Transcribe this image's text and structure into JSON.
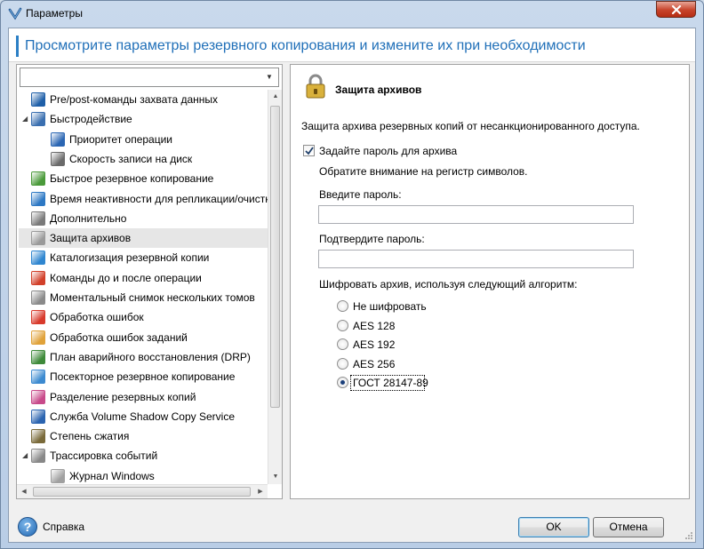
{
  "window": {
    "title": "Параметры"
  },
  "header": {
    "text": "Просмотрите параметры резервного копирования и измените их при необходимости"
  },
  "tree": {
    "items": [
      {
        "label": "Pre/post-команды захвата данных",
        "expander": "",
        "icon": "terminal-icon",
        "color": "#1e5fa8"
      },
      {
        "label": "Быстродействие",
        "expander": "◢",
        "icon": "monitor-icon",
        "color": "#3a6fb0"
      },
      {
        "label": "Приоритет операции",
        "expander": "",
        "icon": "priority-icon",
        "color": "#2b66b3"
      },
      {
        "label": "Скорость записи на диск",
        "expander": "",
        "icon": "disk-speed-icon",
        "color": "#6a6a6a"
      },
      {
        "label": "Быстрое резервное копирование",
        "expander": "",
        "icon": "fast-backup-icon",
        "color": "#4a9a3a"
      },
      {
        "label": "Время неактивности для репликации/очистки",
        "expander": "",
        "icon": "clock-icon",
        "color": "#2d78c4"
      },
      {
        "label": "Дополнительно",
        "expander": "",
        "icon": "gear-icon",
        "color": "#7a7a7a"
      },
      {
        "label": "Защита архивов",
        "expander": "",
        "icon": "lock-icon",
        "color": "#9a9a9a"
      },
      {
        "label": "Каталогизация резервной копии",
        "expander": "",
        "icon": "catalog-icon",
        "color": "#2f86d0"
      },
      {
        "label": "Команды до и после операции",
        "expander": "",
        "icon": "commands-icon",
        "color": "#d2402a"
      },
      {
        "label": "Моментальный снимок нескольких томов",
        "expander": "",
        "icon": "snapshot-icon",
        "color": "#8a8a8a"
      },
      {
        "label": "Обработка ошибок",
        "expander": "",
        "icon": "error-icon",
        "color": "#d83a2c"
      },
      {
        "label": "Обработка ошибок заданий",
        "expander": "",
        "icon": "task-error-icon",
        "color": "#e0a23a"
      },
      {
        "label": "План аварийного восстановления (DRP)",
        "expander": "",
        "icon": "drp-icon",
        "color": "#3e8a3a"
      },
      {
        "label": "Посекторное резервное копирование",
        "expander": "",
        "icon": "sector-icon",
        "color": "#3c8ad0"
      },
      {
        "label": "Разделение резервных копий",
        "expander": "",
        "icon": "split-icon",
        "color": "#c84a8a"
      },
      {
        "label": "Служба Volume Shadow Copy Service",
        "expander": "",
        "icon": "vss-icon",
        "color": "#2b64b0"
      },
      {
        "label": "Степень сжатия",
        "expander": "",
        "icon": "compression-icon",
        "color": "#7a6a3a"
      },
      {
        "label": "Трассировка событий",
        "expander": "◢",
        "icon": "tracing-icon",
        "color": "#888888"
      },
      {
        "label": "Журнал Windows",
        "expander": "",
        "icon": "log-icon",
        "color": "#a0a0a0"
      }
    ]
  },
  "panel": {
    "title": "Защита архивов",
    "description": "Защита архива резервных копий от несанкционированного доступа.",
    "password_checkbox_label": "Задайте пароль для архива",
    "password_checked": true,
    "case_note": "Обратите внимание на регистр символов.",
    "password_label": "Введите пароль:",
    "password_value": "",
    "confirm_label": "Подтвердите пароль:",
    "confirm_value": "",
    "algorithm_label": "Шифровать архив, используя следующий алгоритм:",
    "algorithms": [
      "Не шифровать",
      "AES 128",
      "AES 192",
      "AES 256",
      "ГОСТ 28147-89"
    ],
    "selected_algorithm": "ГОСТ 28147-89"
  },
  "footer": {
    "help_label": "Справка",
    "ok_label": "OK",
    "cancel_label": "Отмена"
  },
  "colors": {
    "accent": "#1f6fb8",
    "selection": "#e6e6e6",
    "close": "#c7432a"
  }
}
